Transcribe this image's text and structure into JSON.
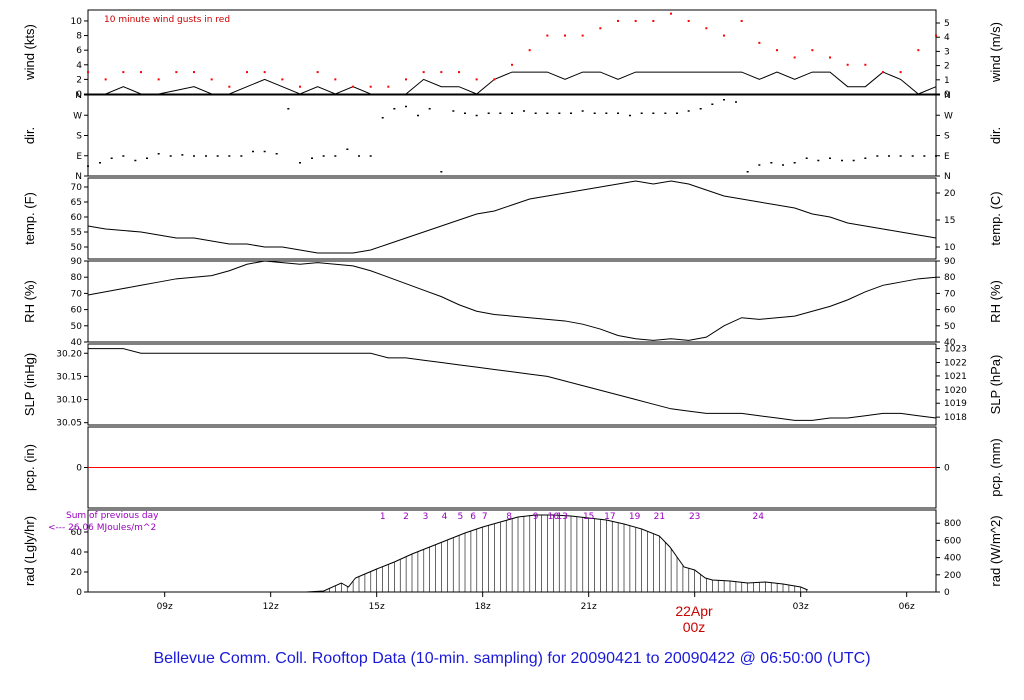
{
  "title": "Bellevue Comm. Coll. Rooftop Data (10-min. sampling) for 20090421  to  20090422 @ 06:50:00  (UTC)",
  "gust_note": "10  minute wind gusts in red",
  "rad_note_1": "Sum of previous day",
  "rad_note_2": "<--- 26.06 MJoules/m^2",
  "date_marker": "22Apr",
  "date_marker_time": "00z",
  "x_ticks": [
    "09z",
    "12z",
    "15z",
    "18z",
    "21z",
    "00z",
    "03z",
    "06z"
  ],
  "colors": {
    "gust": "#ff0000",
    "zero_line": "#ff0000",
    "purple": "#9a00c0",
    "footer": "#1a1ad8"
  },
  "chart_data": [
    {
      "type": "line",
      "name": "wind",
      "ylabel": "wind (kts)",
      "ylabel_right": "wind (m/s)",
      "ylim": [
        0,
        11.5
      ],
      "yticks_left": [
        0,
        2,
        4,
        6,
        8,
        10
      ],
      "yticks_right_labels": [
        "0",
        "1",
        "2",
        "3",
        "4",
        "5"
      ],
      "yticks_right_values": [
        0,
        1.944,
        3.888,
        5.832,
        7.776,
        9.72
      ],
      "series": [
        {
          "name": "wind speed",
          "x": [
            6.83,
            7.33,
            7.83,
            8.33,
            8.83,
            9.33,
            9.83,
            10.33,
            10.83,
            11.33,
            11.83,
            12.33,
            12.83,
            13.33,
            13.83,
            14.33,
            14.83,
            15.33,
            15.83,
            16.33,
            16.83,
            17.33,
            17.83,
            18.33,
            18.83,
            19.33,
            19.83,
            20.33,
            20.83,
            21.33,
            21.83,
            22.33,
            22.83,
            23.33,
            23.83,
            24.33,
            24.83,
            25.33,
            25.83,
            26.33,
            26.83,
            27.33,
            27.83,
            28.33,
            28.83,
            29.33,
            29.83,
            30.33,
            30.83
          ],
          "y": [
            0,
            0,
            1,
            0,
            0,
            0.5,
            1,
            0,
            0,
            1,
            2,
            1,
            0,
            1,
            0,
            1,
            0,
            0,
            0,
            2,
            1,
            1,
            0,
            2,
            3,
            3,
            3,
            2,
            3,
            3,
            2,
            3,
            3,
            3,
            3,
            3,
            3,
            3,
            2,
            3,
            2,
            3,
            3,
            1,
            1,
            3,
            2,
            0,
            1
          ]
        },
        {
          "name": "10 minute wind gusts",
          "x": [
            6.83,
            7.33,
            7.83,
            8.33,
            8.83,
            9.33,
            9.83,
            10.33,
            10.83,
            11.33,
            11.83,
            12.33,
            12.83,
            13.33,
            13.83,
            14.33,
            14.83,
            15.33,
            15.83,
            16.33,
            16.83,
            17.33,
            17.83,
            18.33,
            18.83,
            19.33,
            19.83,
            20.33,
            20.83,
            21.33,
            21.83,
            22.33,
            22.83,
            23.33,
            23.83,
            24.33,
            24.83,
            25.33,
            25.83,
            26.33,
            26.83,
            27.33,
            27.83,
            28.33,
            28.83,
            29.33,
            29.83,
            30.33,
            30.83
          ],
          "y": [
            3,
            2,
            3,
            3,
            2,
            3,
            3,
            2,
            1,
            3,
            3,
            2,
            1,
            3,
            2,
            1,
            1,
            1,
            2,
            3,
            3,
            3,
            2,
            2,
            4,
            6,
            8,
            8,
            8,
            9,
            10,
            10,
            10,
            11,
            10,
            9,
            8,
            10,
            7,
            6,
            5,
            6,
            5,
            4,
            4,
            3,
            3,
            6,
            8
          ]
        }
      ]
    },
    {
      "type": "scatter",
      "name": "dir",
      "ylabel": "dir.",
      "ylabel_right": "dir.",
      "ylim": [
        0,
        360
      ],
      "yticks_left": [
        0,
        90,
        180,
        270,
        360
      ],
      "yticks_left_labels": [
        "N",
        "E",
        "S",
        "W",
        "N"
      ],
      "yticks_right_values": [
        0,
        90,
        180,
        270,
        360
      ],
      "yticks_right_labels": [
        "N",
        "E",
        "S",
        "W",
        "N"
      ],
      "x": [
        6.83,
        7.17,
        7.5,
        7.83,
        8.17,
        8.5,
        8.83,
        9.17,
        9.5,
        9.83,
        10.17,
        10.5,
        10.83,
        11.17,
        11.5,
        11.83,
        12.17,
        12.5,
        12.83,
        13.17,
        13.5,
        13.83,
        14.17,
        14.5,
        14.83,
        15.17,
        15.5,
        15.83,
        16.17,
        16.5,
        16.83,
        17.17,
        17.5,
        17.83,
        18.17,
        18.5,
        18.83,
        19.17,
        19.5,
        19.83,
        20.17,
        20.5,
        20.83,
        21.17,
        21.5,
        21.83,
        22.17,
        22.5,
        22.83,
        23.17,
        23.5,
        23.83,
        24.17,
        24.5,
        24.83,
        25.17,
        25.5,
        25.83,
        26.17,
        26.5,
        26.83,
        27.17,
        27.5,
        27.83,
        28.17,
        28.5,
        28.83,
        29.17,
        29.5,
        29.83,
        30.17,
        30.5,
        30.83
      ],
      "y": [
        45,
        60,
        80,
        90,
        70,
        80,
        100,
        90,
        95,
        90,
        90,
        90,
        90,
        90,
        110,
        110,
        100,
        300,
        60,
        80,
        90,
        90,
        120,
        90,
        90,
        260,
        300,
        310,
        270,
        300,
        20,
        290,
        280,
        270,
        280,
        280,
        280,
        290,
        280,
        280,
        280,
        280,
        290,
        280,
        280,
        280,
        270,
        280,
        280,
        280,
        280,
        290,
        300,
        320,
        340,
        330,
        20,
        50,
        60,
        50,
        60,
        80,
        70,
        80,
        70,
        70,
        80,
        90,
        90,
        90,
        90,
        90,
        90
      ]
    },
    {
      "type": "line",
      "name": "temp",
      "ylabel": "temp. (F)",
      "ylabel_right": "temp. (C)",
      "ylim": [
        46,
        73
      ],
      "yticks_left": [
        50,
        55,
        60,
        65,
        70
      ],
      "yticks_right_labels": [
        "10",
        "15",
        "20"
      ],
      "yticks_right_values": [
        50,
        59,
        68
      ],
      "x": [
        6.83,
        7.33,
        7.83,
        8.33,
        8.83,
        9.33,
        9.83,
        10.33,
        10.83,
        11.33,
        11.83,
        12.33,
        12.83,
        13.33,
        13.83,
        14.33,
        14.83,
        15.33,
        15.83,
        16.33,
        16.83,
        17.33,
        17.83,
        18.33,
        18.83,
        19.33,
        19.83,
        20.33,
        20.83,
        21.33,
        21.83,
        22.33,
        22.83,
        23.33,
        23.83,
        24.33,
        24.83,
        25.33,
        25.83,
        26.33,
        26.83,
        27.33,
        27.83,
        28.33,
        28.83,
        29.33,
        29.83,
        30.33,
        30.83
      ],
      "y": [
        57,
        56,
        55.5,
        55,
        54,
        53,
        53,
        52,
        51,
        51,
        50,
        50,
        49,
        48,
        48,
        48,
        49,
        51,
        53,
        55,
        57,
        59,
        61,
        62,
        64,
        66,
        67,
        68,
        69,
        70,
        71,
        72,
        71,
        72,
        71,
        69,
        67,
        66,
        65,
        64,
        63,
        61,
        60,
        58,
        57,
        56,
        55,
        54,
        53
      ]
    },
    {
      "type": "line",
      "name": "rh",
      "ylabel": "RH (%)",
      "ylabel_right": "RH (%)",
      "ylim": [
        40,
        90
      ],
      "yticks_left": [
        40,
        50,
        60,
        70,
        80,
        90
      ],
      "yticks_right_labels": [
        "40",
        "50",
        "60",
        "70",
        "80",
        "90"
      ],
      "yticks_right_values": [
        40,
        50,
        60,
        70,
        80,
        90
      ],
      "x": [
        6.83,
        7.33,
        7.83,
        8.33,
        8.83,
        9.33,
        9.83,
        10.33,
        10.83,
        11.33,
        11.83,
        12.33,
        12.83,
        13.33,
        13.83,
        14.33,
        14.83,
        15.33,
        15.83,
        16.33,
        16.83,
        17.33,
        17.83,
        18.33,
        18.83,
        19.33,
        19.83,
        20.33,
        20.83,
        21.33,
        21.83,
        22.33,
        22.83,
        23.33,
        23.83,
        24.33,
        24.83,
        25.33,
        25.83,
        26.33,
        26.83,
        27.33,
        27.83,
        28.33,
        28.83,
        29.33,
        29.83,
        30.33,
        30.83
      ],
      "y": [
        69,
        71,
        73,
        75,
        77,
        79,
        80,
        81,
        84,
        88,
        90,
        89,
        88,
        89,
        88,
        87,
        84,
        80,
        76,
        72,
        68,
        63,
        59,
        57,
        56,
        55,
        54,
        53,
        51,
        48,
        44,
        42,
        41,
        42,
        41,
        43,
        50,
        55,
        54,
        55,
        56,
        59,
        62,
        66,
        71,
        75,
        77,
        79,
        80
      ]
    },
    {
      "type": "line",
      "name": "slp",
      "ylabel": "SLP (inHg)",
      "ylabel_right": "SLP (hPa)",
      "ylim": [
        30.045,
        30.22
      ],
      "yticks_left": [
        30.05,
        30.1,
        30.15,
        30.2
      ],
      "yticks_left_labels": [
        "30.05",
        "30.10",
        "30.15",
        "30.20"
      ],
      "yticks_right_labels": [
        "1018",
        "1019",
        "1020",
        "1021",
        "1022",
        "1023"
      ],
      "yticks_right_values": [
        30.062,
        30.092,
        30.121,
        30.151,
        30.18,
        30.21
      ],
      "x": [
        6.83,
        7.33,
        7.83,
        8.33,
        8.83,
        9.33,
        9.83,
        10.33,
        10.83,
        11.33,
        11.83,
        12.33,
        12.83,
        13.33,
        13.83,
        14.33,
        14.83,
        15.33,
        15.83,
        16.33,
        16.83,
        17.33,
        17.83,
        18.33,
        18.83,
        19.33,
        19.83,
        20.33,
        20.83,
        21.33,
        21.83,
        22.33,
        22.83,
        23.33,
        23.83,
        24.33,
        24.83,
        25.33,
        25.83,
        26.33,
        26.83,
        27.33,
        27.83,
        28.33,
        28.83,
        29.33,
        29.83,
        30.33,
        30.83
      ],
      "y": [
        30.21,
        30.21,
        30.21,
        30.2,
        30.2,
        30.2,
        30.2,
        30.2,
        30.2,
        30.2,
        30.2,
        30.2,
        30.2,
        30.2,
        30.2,
        30.2,
        30.2,
        30.19,
        30.19,
        30.185,
        30.18,
        30.175,
        30.17,
        30.165,
        30.16,
        30.155,
        30.15,
        30.14,
        30.13,
        30.12,
        30.11,
        30.1,
        30.09,
        30.08,
        30.075,
        30.07,
        30.07,
        30.07,
        30.065,
        30.06,
        30.055,
        30.055,
        30.06,
        30.06,
        30.065,
        30.07,
        30.07,
        30.065,
        30.06
      ]
    },
    {
      "type": "line",
      "name": "pcp",
      "ylabel": "pcp. (in)",
      "ylabel_right": "pcp. (mm)",
      "ylim": [
        -1,
        1
      ],
      "yticks_left": [
        0
      ],
      "yticks_left_labels": [
        "0"
      ],
      "yticks_right_labels": [
        "0"
      ],
      "yticks_right_values": [
        0
      ],
      "x": [
        6.83,
        30.83
      ],
      "y": [
        0,
        0
      ]
    },
    {
      "type": "area",
      "name": "rad",
      "ylabel": "rad (Lgly/hr)",
      "ylabel_right": "rad (W/m^2)",
      "ylim": [
        0,
        82
      ],
      "yticks_left": [
        0,
        20,
        40,
        60
      ],
      "yticks_right_labels": [
        "0",
        "200",
        "400",
        "600",
        "800"
      ],
      "yticks_right_values": [
        0,
        17.2,
        34.4,
        51.6,
        68.8
      ],
      "x": [
        13.0,
        13.5,
        14.0,
        14.2,
        14.4,
        14.6,
        15.0,
        15.5,
        16.0,
        16.5,
        17.0,
        17.5,
        18.0,
        18.5,
        19.0,
        19.5,
        20.0,
        20.5,
        21.0,
        21.5,
        22.0,
        22.5,
        23.0,
        23.3,
        23.5,
        23.7,
        24.0,
        24.3,
        24.5,
        25.0,
        25.5,
        26.0,
        26.5,
        27.0,
        27.2
      ],
      "y": [
        0,
        1,
        9,
        5,
        14,
        17,
        23,
        30,
        38,
        45,
        52,
        59,
        65,
        70,
        75,
        77,
        77,
        76,
        74,
        72,
        68,
        63,
        56,
        45,
        35,
        25,
        22,
        14,
        12,
        11,
        9,
        10,
        8,
        5,
        2
      ],
      "hour_labels": [
        "1",
        "2",
        "3",
        "4",
        "5",
        "6",
        "7",
        "8",
        "9",
        "10",
        "13",
        "15",
        "17",
        "19",
        "21",
        "23",
        "24"
      ],
      "hour_label_x": [
        15.17,
        15.83,
        16.38,
        16.92,
        17.37,
        17.73,
        18.06,
        18.75,
        19.5,
        20.0,
        20.25,
        21.0,
        21.6,
        22.3,
        23.0,
        24.0,
        25.8
      ]
    }
  ]
}
